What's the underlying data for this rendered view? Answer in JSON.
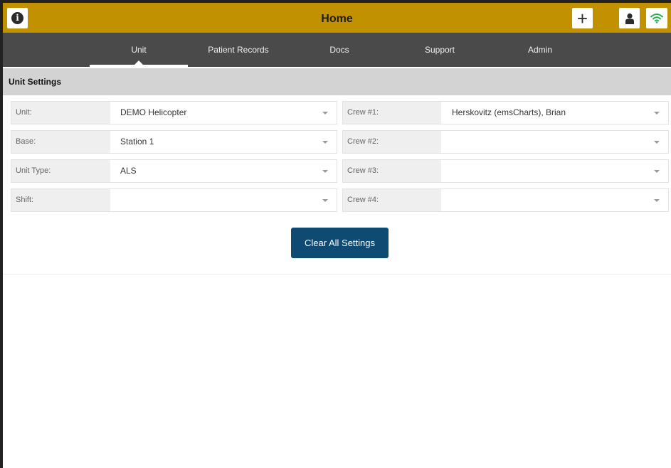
{
  "header": {
    "title": "Home",
    "info_icon": "info-icon",
    "add_icon": "plus-icon",
    "user_icon": "user-icon",
    "wifi_icon": "wifi-icon",
    "accent": "#c29100",
    "wifi_color": "#22b14c"
  },
  "nav": {
    "tabs": [
      {
        "label": "Unit",
        "active": true
      },
      {
        "label": "Patient Records",
        "active": false
      },
      {
        "label": "Docs",
        "active": false
      },
      {
        "label": "Support",
        "active": false
      },
      {
        "label": "Admin",
        "active": false
      }
    ]
  },
  "section": {
    "title": "Unit Settings"
  },
  "left_fields": [
    {
      "label": "Unit:",
      "value": "DEMO Helicopter"
    },
    {
      "label": "Base:",
      "value": "Station 1"
    },
    {
      "label": "Unit Type:",
      "value": "ALS"
    },
    {
      "label": "Shift:",
      "value": ""
    }
  ],
  "right_fields": [
    {
      "label": "Crew #1:",
      "value": "Herskovitz (emsCharts), Brian"
    },
    {
      "label": "Crew #2:",
      "value": ""
    },
    {
      "label": "Crew #3:",
      "value": ""
    },
    {
      "label": "Crew #4:",
      "value": ""
    }
  ],
  "actions": {
    "clear_label": "Clear All Settings",
    "button_color": "#0e4a72"
  }
}
